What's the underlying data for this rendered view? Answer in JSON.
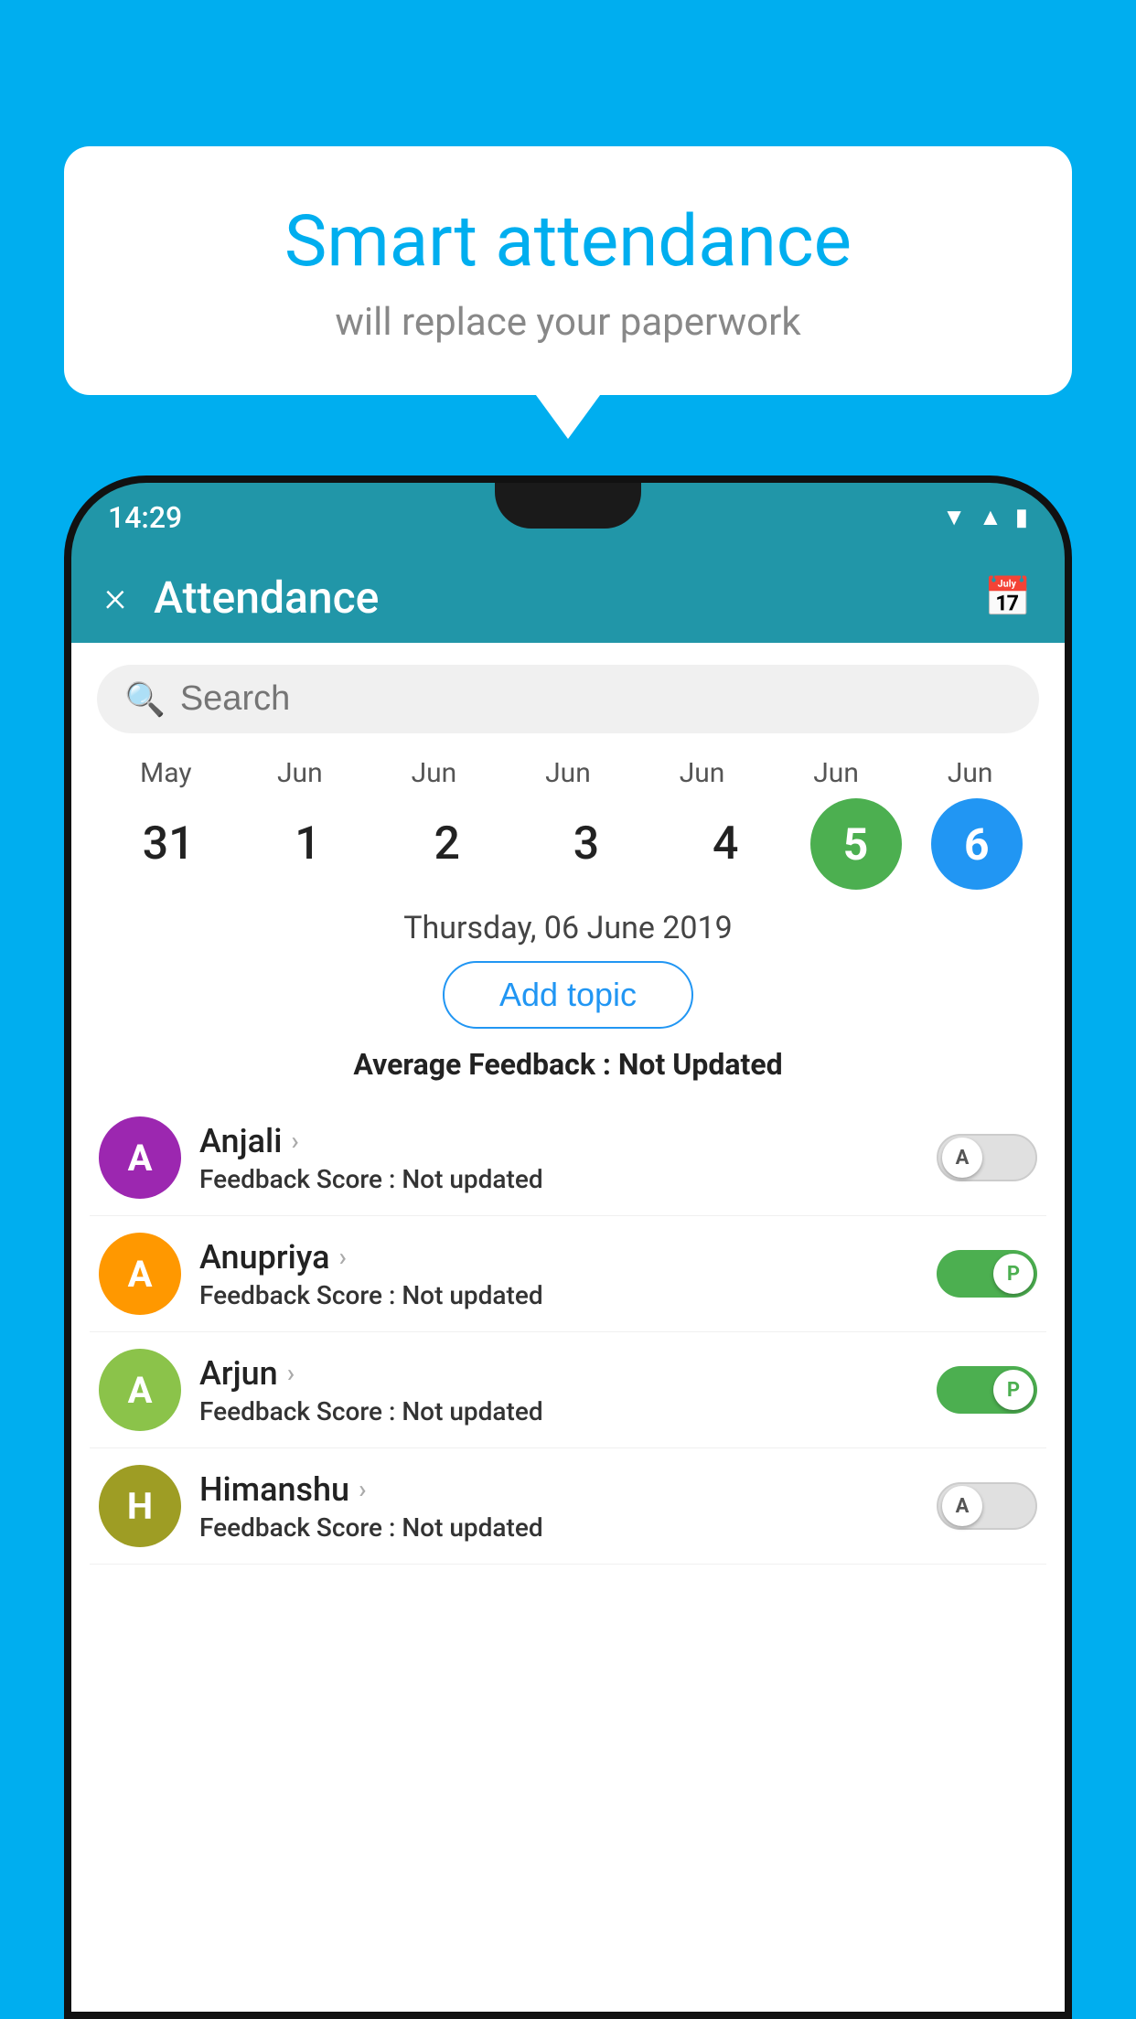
{
  "background_color": "#00AEEF",
  "speech_bubble": {
    "title": "Smart attendance",
    "subtitle": "will replace your paperwork"
  },
  "status_bar": {
    "time": "14:29",
    "icons": [
      "wifi",
      "signal",
      "battery"
    ]
  },
  "app_bar": {
    "close_label": "×",
    "title": "Attendance",
    "calendar_icon": "📅"
  },
  "search": {
    "placeholder": "Search"
  },
  "calendar": {
    "months": [
      "May",
      "Jun",
      "Jun",
      "Jun",
      "Jun",
      "Jun",
      "Jun"
    ],
    "dates": [
      "31",
      "1",
      "2",
      "3",
      "4",
      "5",
      "6"
    ],
    "today_index": 5,
    "selected_index": 6,
    "selected_date_label": "Thursday, 06 June 2019"
  },
  "add_topic": {
    "label": "Add topic"
  },
  "average_feedback": {
    "label": "Average Feedback : ",
    "value": "Not Updated"
  },
  "students": [
    {
      "name": "Anjali",
      "avatar_letter": "A",
      "avatar_color": "purple",
      "feedback_label": "Feedback Score : ",
      "feedback_value": "Not updated",
      "toggle": "off",
      "toggle_letter": "A"
    },
    {
      "name": "Anupriya",
      "avatar_letter": "A",
      "avatar_color": "orange",
      "feedback_label": "Feedback Score : ",
      "feedback_value": "Not updated",
      "toggle": "on",
      "toggle_letter": "P"
    },
    {
      "name": "Arjun",
      "avatar_letter": "A",
      "avatar_color": "light-green",
      "feedback_label": "Feedback Score : ",
      "feedback_value": "Not updated",
      "toggle": "on",
      "toggle_letter": "P"
    },
    {
      "name": "Himanshu",
      "avatar_letter": "H",
      "avatar_color": "olive",
      "feedback_label": "Feedback Score : ",
      "feedback_value": "Not updated",
      "toggle": "off",
      "toggle_letter": "A"
    }
  ]
}
